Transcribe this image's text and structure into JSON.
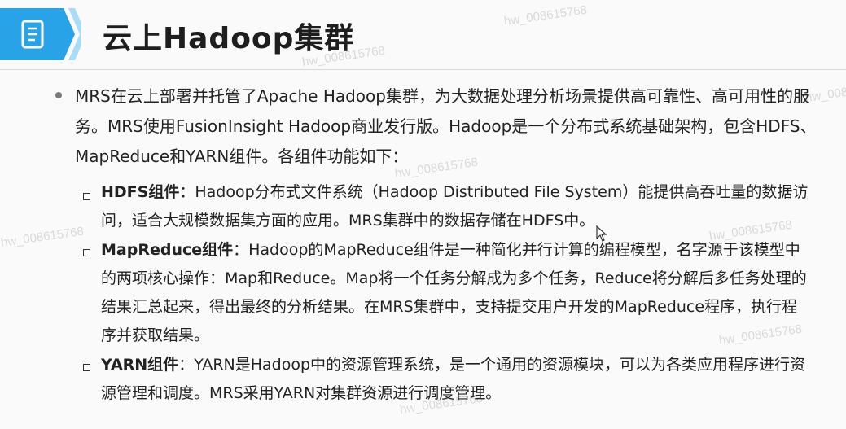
{
  "header": {
    "title": "云上Hadoop集群",
    "icon": "document-list-icon",
    "accent_color": "#29a3e8",
    "accent_light": "#a9dcf6"
  },
  "watermark": "hw_008615768",
  "intro": "MRS在云上部署并托管了Apache  Hadoop集群，为大数据处理分析场景提供高可靠性、高可用性的服务。MRS使用FusionInsight  Hadoop商业发行版。Hadoop是一个分布式系统基础架构，包含HDFS、MapReduce和YARN组件。各组件功能如下：",
  "items": [
    {
      "name": "HDFS组件",
      "text": "：Hadoop分布式文件系统（Hadoop Distributed File System）能提供高吞吐量的数据访问，适合大规模数据集方面的应用。MRS集群中的数据存储在HDFS中。"
    },
    {
      "name": "MapReduce组件",
      "text": "：Hadoop的MapReduce组件是一种简化并行计算的编程模型，名字源于该模型中的两项核心操作：Map和Reduce。Map将一个任务分解成为多个任务，Reduce将分解后多任务处理的结果汇总起来，得出最终的分析结果。在MRS集群中，支持提交用户开发的MapReduce程序，执行程序并获取结果。"
    },
    {
      "name": "YARN组件",
      "text": "：YARN是Hadoop中的资源管理系统，是一个通用的资源模块，可以为各类应用程序进行资源管理和调度。MRS采用YARN对集群资源进行调度管理。"
    }
  ]
}
